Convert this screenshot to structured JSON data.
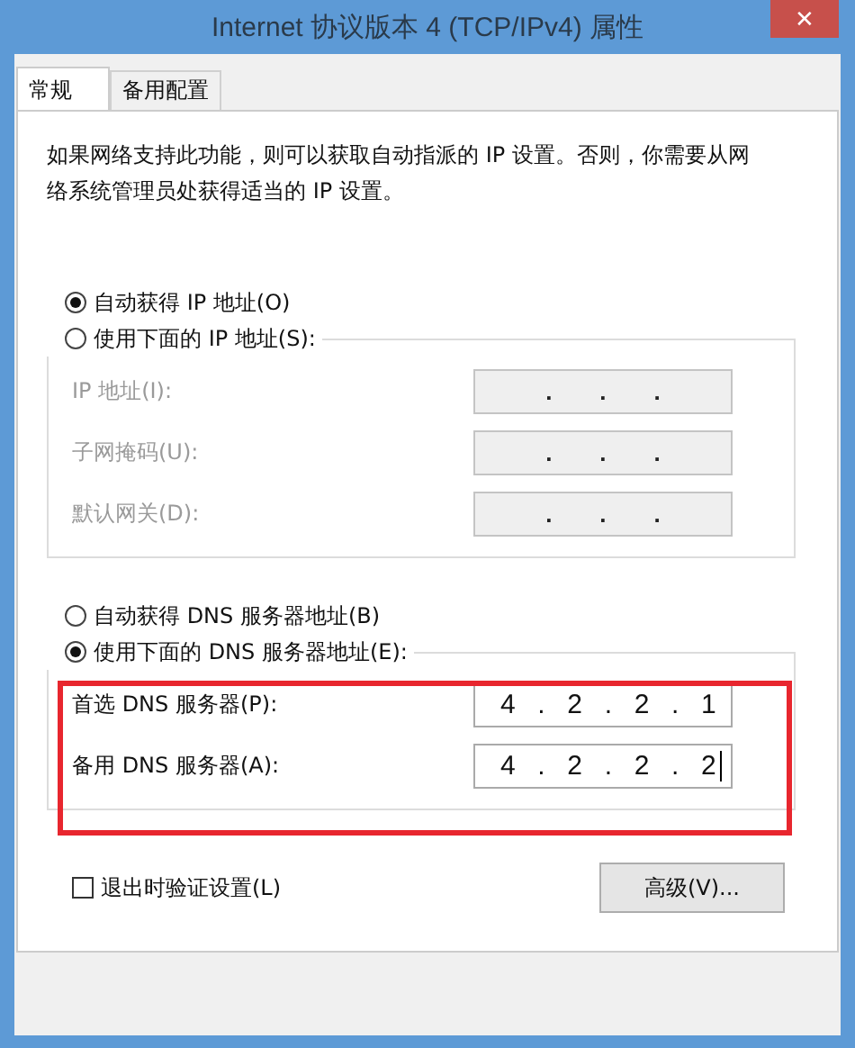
{
  "window": {
    "title": "Internet 协议版本 4 (TCP/IPv4) 属性",
    "close": "✕"
  },
  "tabs": [
    {
      "label": "常规",
      "selected": true
    },
    {
      "label": "备用配置",
      "selected": false
    }
  ],
  "description": "如果网络支持此功能，则可以获取自动指派的 IP 设置。否则，你需要从网络系统管理员处获得适当的 IP 设置。",
  "ip_mode": {
    "options": [
      {
        "label": "自动获得 IP 地址(O)",
        "selected": true
      },
      {
        "label": "使用下面的 IP 地址(S):",
        "selected": false
      }
    ],
    "fields": [
      {
        "label": "IP 地址(I):",
        "value": ".    .    .",
        "disabled": true
      },
      {
        "label": "子网掩码(U):",
        "value": ".    .    .",
        "disabled": true
      },
      {
        "label": "默认网关(D):",
        "value": ".    .    .",
        "disabled": true
      }
    ]
  },
  "dns_mode": {
    "options": [
      {
        "label": "自动获得 DNS 服务器地址(B)",
        "selected": false
      },
      {
        "label": "使用下面的 DNS 服务器地址(E):",
        "selected": true
      }
    ],
    "fields": [
      {
        "label": "首选 DNS 服务器(P):",
        "value": "4  .  2  .  2  .  1",
        "disabled": false
      },
      {
        "label": "备用 DNS 服务器(A):",
        "value": "4  .  2  .  2  .  2",
        "disabled": false
      }
    ]
  },
  "validate_on_exit": {
    "label": "退出时验证设置(L)",
    "checked": false
  },
  "advanced_button": "高级(V)...",
  "annotation": {
    "kind": "highlight",
    "color": "#e8262e"
  }
}
